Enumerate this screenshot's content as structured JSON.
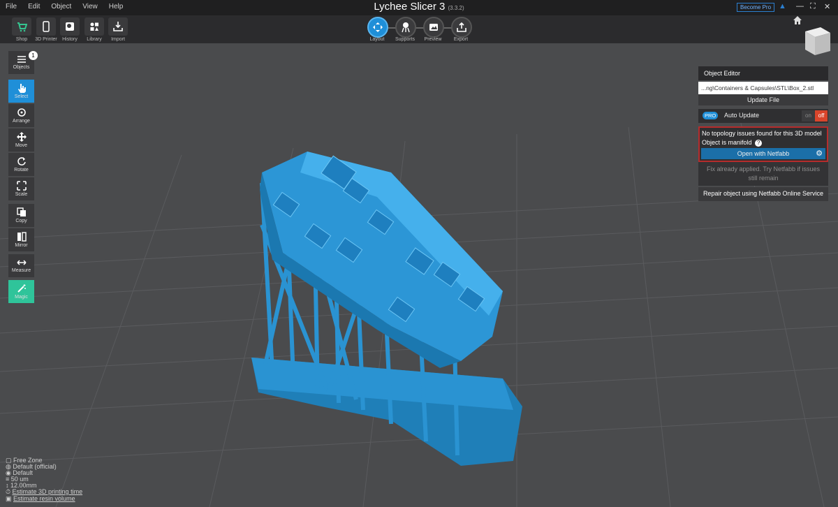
{
  "menu": [
    "File",
    "Edit",
    "Object",
    "View",
    "Help"
  ],
  "title": {
    "name": "Lychee Slicer 3",
    "version": "(3.3.2)"
  },
  "become_pro": "Become Pro",
  "toolbar": {
    "shop": "Shop",
    "printer": "3D Printer",
    "history": "History",
    "library": "Library",
    "import": "Import"
  },
  "modes": {
    "layout": "Layout",
    "supports": "Supports",
    "preview": "Preview",
    "export": "Export"
  },
  "sidebar": {
    "objects": "Objects",
    "objects_count": "1",
    "select": "Select",
    "arrange": "Arrange",
    "move": "Move",
    "rotate": "Rotate",
    "scale": "Scale",
    "copy": "Copy",
    "mirror": "Mirror",
    "measure": "Measure",
    "magic": "Magic"
  },
  "panel": {
    "title": "Object Editor",
    "file_path": "...ng\\Containers & Capsules\\STL\\Box_2.stl",
    "update_file": "Update File",
    "pro": "PRO",
    "auto_update": "Auto Update",
    "on": "on",
    "off": "off",
    "topology": "No topology issues found for this 3D model",
    "manifold": "Object is manifold",
    "open_netfabb": "Open with Netfabb",
    "fix_note": "Fix already applied. Try Netfabb if issues still remain",
    "repair": "Repair object using Netfabb Online Service"
  },
  "bottom_info": {
    "zone": "Free Zone",
    "default_official": "Default  (official)",
    "default": "Default",
    "layer": "50 um",
    "height": "12.00mm",
    "estimate_time": "Estimate 3D printing time",
    "estimate_volume": "Estimate resin volume"
  },
  "colors": {
    "accent": "#1f8fd8",
    "model": "#2a8fcf",
    "danger": "#d9452b"
  }
}
